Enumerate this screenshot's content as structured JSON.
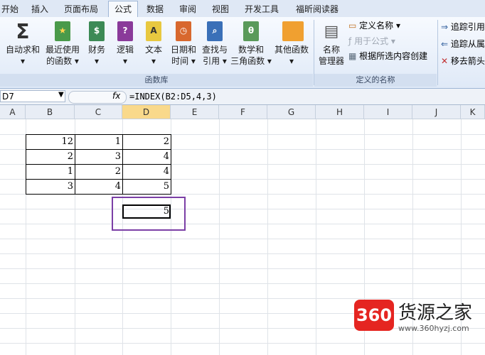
{
  "tabs": [
    "开始",
    "插入",
    "页面布局",
    "公式",
    "数据",
    "审阅",
    "视图",
    "开发工具",
    "福昕阅读器"
  ],
  "active_tab": "公式",
  "ribbon": {
    "function_library": {
      "label": "函数库",
      "buttons": [
        {
          "line1": "自动求和",
          "line2": "▾",
          "icon": "sigma-icon"
        },
        {
          "line1": "最近使用",
          "line2": "的函数 ▾",
          "icon": "recent-book-icon"
        },
        {
          "line1": "财务",
          "line2": "▾",
          "icon": "finance-book-icon"
        },
        {
          "line1": "逻辑",
          "line2": "▾",
          "icon": "logic-book-icon"
        },
        {
          "line1": "文本",
          "line2": "▾",
          "icon": "text-book-icon"
        },
        {
          "line1": "日期和",
          "line2": "时间 ▾",
          "icon": "date-book-icon"
        },
        {
          "line1": "查找与",
          "line2": "引用 ▾",
          "icon": "lookup-book-icon"
        },
        {
          "line1": "数学和",
          "line2": "三角函数 ▾",
          "icon": "math-book-icon"
        },
        {
          "line1": "其他函数",
          "line2": "▾",
          "icon": "other-book-icon"
        }
      ]
    },
    "defined_names": {
      "label": "定义的名称",
      "manager": {
        "line1": "名称",
        "line2": "管理器"
      },
      "define_name": "定义名称 ▾",
      "use_in_formula": "用于公式 ▾",
      "create_from_selection": "根据所选内容创建"
    },
    "formula_auditing": {
      "trace_precedents": "追踪引用",
      "trace_dependents": "追踪从属",
      "remove_arrows": "移去箭头"
    }
  },
  "formula_bar": {
    "name_box": "D7",
    "fx": "fx",
    "formula": "=INDEX(B2:D5,4,3)"
  },
  "columns": [
    "A",
    "B",
    "C",
    "D",
    "E",
    "F",
    "G",
    "H",
    "I",
    "J",
    "K"
  ],
  "selected_column": "D",
  "table": [
    [
      "12",
      "1",
      "2"
    ],
    [
      "2",
      "3",
      "4"
    ],
    [
      "1",
      "2",
      "4"
    ],
    [
      "3",
      "4",
      "5"
    ]
  ],
  "result": "5",
  "watermark": {
    "badge": "360",
    "name": "货源之家",
    "url": "www.360hyzj.com"
  },
  "colors": {
    "highlight": "#7b3fa6",
    "badge": "#e52521"
  }
}
